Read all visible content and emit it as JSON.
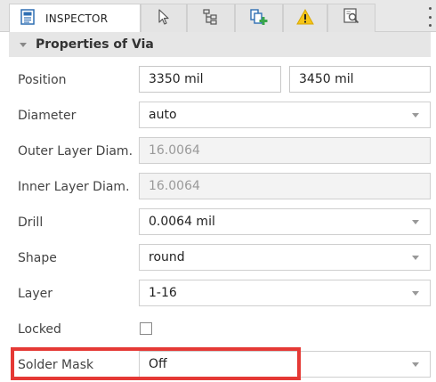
{
  "tabs": [
    {
      "label": "INSPECTOR",
      "icon": "inspector-icon"
    },
    {
      "label": "",
      "icon": "cursor-icon"
    },
    {
      "label": "",
      "icon": "hierarchy-icon"
    },
    {
      "label": "",
      "icon": "add-part-icon"
    },
    {
      "label": "",
      "icon": "warning-icon"
    },
    {
      "label": "",
      "icon": "search-document-icon"
    }
  ],
  "section": {
    "title": "Properties of Via"
  },
  "properties": {
    "position": {
      "label": "Position",
      "x": "3350 mil",
      "y": "3450 mil"
    },
    "diameter": {
      "label": "Diameter",
      "value": "auto"
    },
    "outer_layer_diam": {
      "label": "Outer Layer Diam.",
      "value": "16.0064"
    },
    "inner_layer_diam": {
      "label": "Inner Layer Diam.",
      "value": "16.0064"
    },
    "drill": {
      "label": "Drill",
      "value": "0.0064 mil"
    },
    "shape": {
      "label": "Shape",
      "value": "round"
    },
    "layer": {
      "label": "Layer",
      "value": "1-16"
    },
    "locked": {
      "label": "Locked",
      "checked": false
    },
    "solder_mask": {
      "label": "Solder Mask",
      "value": "Off"
    }
  },
  "colors": {
    "highlight": "#e53935",
    "warning": "#f5c518",
    "accent_green": "#3aa64b",
    "icon_blue": "#2f6fb3"
  }
}
